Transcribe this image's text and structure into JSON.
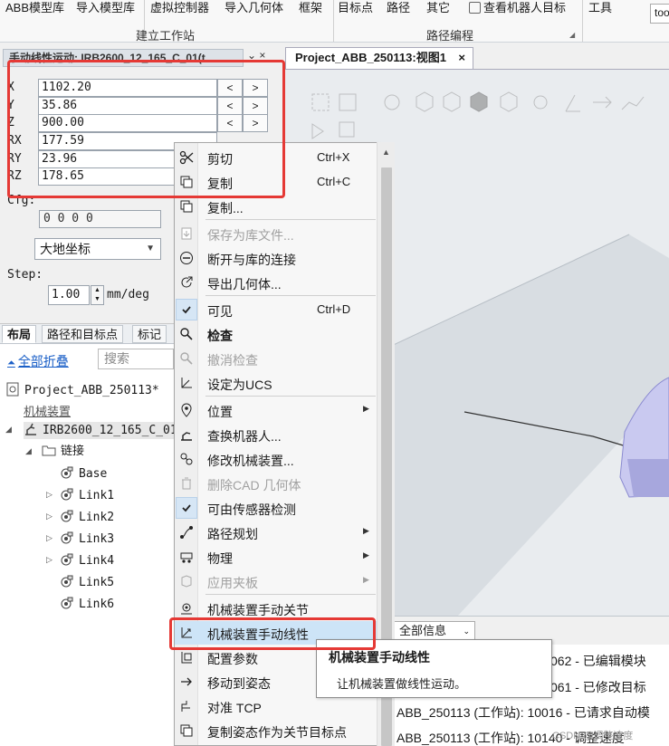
{
  "ribbon": {
    "items": [
      {
        "label": "ABB模型库",
        "has_menu": true
      },
      {
        "label": "导入模型库",
        "has_menu": true
      },
      {
        "label": "虚拟控制器",
        "has_menu": true
      },
      {
        "label": "导入几何体",
        "has_menu": true
      },
      {
        "label": "框架",
        "has_menu": true
      },
      {
        "label": "目标点",
        "has_menu": true
      },
      {
        "label": "路径",
        "has_menu": true
      },
      {
        "label": "其它",
        "has_menu": true
      },
      {
        "label": "查看机器人目标",
        "has_menu": false
      },
      {
        "label": "工具",
        "has_menu": false
      }
    ],
    "groups": [
      "建立工作站",
      "路径编程"
    ],
    "tail_text": "too"
  },
  "jog_panel": {
    "tab_title": "手动线性运动: IRB2600_12_165_C_01(t",
    "tab_controls": "⌄ ×",
    "fields": [
      {
        "label": "X",
        "value": "1102.20"
      },
      {
        "label": "Y",
        "value": "35.86"
      },
      {
        "label": "Z",
        "value": "900.00"
      },
      {
        "label": "RX",
        "value": "177.59"
      },
      {
        "label": "RY",
        "value": "23.96"
      },
      {
        "label": "RZ",
        "value": "178.65"
      }
    ],
    "dec_glyph": "<",
    "inc_glyph": ">",
    "cfg_label": "Cfg:",
    "cfg_value": "0 0 0 0",
    "coord_system": "大地坐标",
    "step_label": "Step:",
    "step_value": "1.00",
    "step_unit": "mm/deg"
  },
  "layout_panel": {
    "tabs": [
      {
        "label": "布局",
        "active": true
      },
      {
        "label": "路径和目标点",
        "active": false
      },
      {
        "label": "标记",
        "active": false
      }
    ],
    "collapse_all": "全部折叠",
    "search_placeholder": "搜索",
    "project": "Project_ABB_250113*",
    "section": "机械装置",
    "robot": "IRB2600_12_165_C_01",
    "links_folder": "链接",
    "links": [
      "Base",
      "Link1",
      "Link2",
      "Link3",
      "Link4",
      "Link5",
      "Link6"
    ]
  },
  "viewport": {
    "tab_title": "Project_ABB_250113:视图1",
    "close_glyph": "×"
  },
  "output": {
    "filter": "全部信息",
    "lines": [
      "062 - 已编辑模块",
      "061 - 已修改目标",
      "ABB_250113 (工作站): 10016 - 已请求自动模",
      "ABB_250113 (工作站): 10140 - 调整速度"
    ]
  },
  "context_menu": {
    "items": [
      {
        "label": "剪切",
        "shortcut": "Ctrl+X",
        "icon": "scissors-icon"
      },
      {
        "label": "复制",
        "shortcut": "Ctrl+C",
        "icon": "copy-icon"
      },
      {
        "sep": true
      },
      {
        "label": "复制...",
        "icon": "duplicate-icon"
      },
      {
        "label": "保存为库文件...",
        "disabled": true,
        "icon": "save-library-icon"
      },
      {
        "label": "断开与库的连接",
        "icon": "disconnect-icon"
      },
      {
        "label": "导出几何体...",
        "icon": "export-geometry-icon"
      },
      {
        "sep": true
      },
      {
        "label": "可见",
        "shortcut": "Ctrl+D",
        "checked": true,
        "icon": "check-icon"
      },
      {
        "label": "检查",
        "bold": true,
        "icon": "inspect-icon"
      },
      {
        "label": "撤消检查",
        "disabled": true,
        "icon": "undo-inspect-icon"
      },
      {
        "label": "设定为UCS",
        "icon": "ucs-icon"
      },
      {
        "sep": true
      },
      {
        "label": "位置",
        "submenu": true,
        "icon": "position-icon"
      },
      {
        "label": "查换机器人...",
        "icon": "swap-robot-icon"
      },
      {
        "label": "修改机械装置...",
        "icon": "modify-mechanism-icon"
      },
      {
        "label": "删除CAD 几何体",
        "disabled": true,
        "icon": "delete-icon"
      },
      {
        "label": "可由传感器检测",
        "checked": true,
        "icon": "check-icon"
      },
      {
        "label": "路径规划",
        "submenu": true,
        "icon": "path-plan-icon"
      },
      {
        "label": "物理",
        "submenu": true,
        "icon": "physics-icon"
      },
      {
        "label": "应用夹板",
        "submenu": true,
        "disabled": true,
        "icon": "fixture-icon"
      },
      {
        "sep": true
      },
      {
        "label": "机械装置手动关节",
        "icon": "joint-jog-icon"
      },
      {
        "label": "机械装置手动线性",
        "highlighted": true,
        "icon": "linear-jog-icon"
      },
      {
        "label": "配置参数",
        "icon": "config-icon"
      },
      {
        "label": "移动到姿态",
        "icon": "arrow-right-icon"
      },
      {
        "label": "对准 TCP",
        "icon": "align-tcp-icon"
      },
      {
        "label": "复制姿态作为关节目标点",
        "icon": "copy-pose-icon"
      }
    ]
  },
  "tooltip": {
    "title": "机械装置手动线性",
    "body": "让机械装置做线性运动。"
  },
  "watermark": "CSDN @调整速度",
  "colors": {
    "annotation": "#e53935",
    "highlight": "#cde4f7",
    "link": "#1a5fc7"
  }
}
